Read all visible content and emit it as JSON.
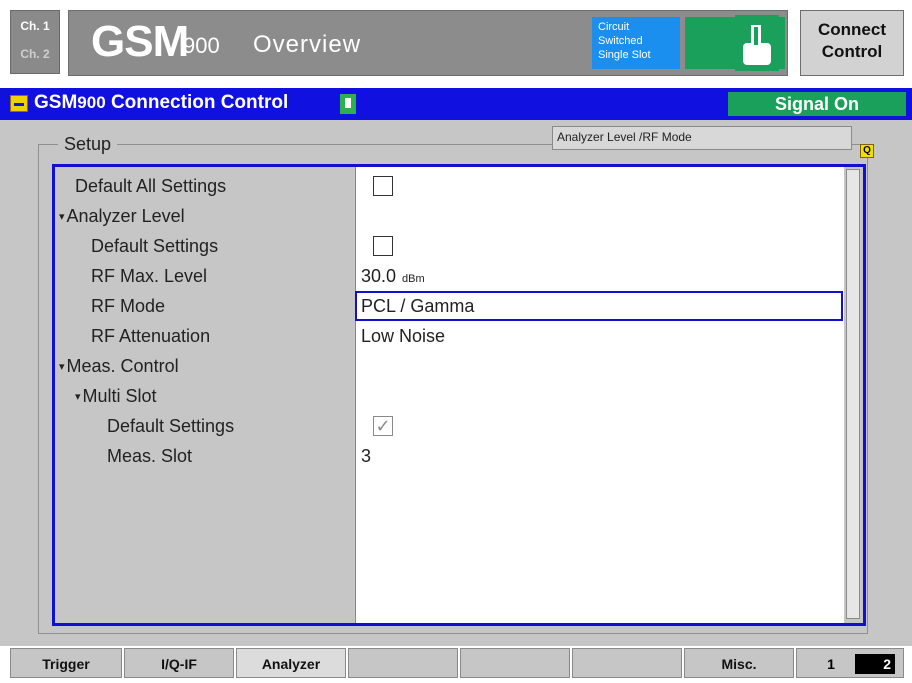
{
  "top": {
    "ch1": "Ch. 1",
    "ch2": "Ch. 2",
    "title_main": "GSM",
    "title_band": "900",
    "title_view": "Overview",
    "mode_lines": [
      "Circuit",
      "Switched",
      "Single Slot"
    ],
    "connect_lines": [
      "Connect",
      "Control"
    ]
  },
  "header": {
    "title_prefix": "GSM",
    "title_band": "900",
    "title": "Connection Control",
    "status": "Signal On",
    "status_color": "#1aa05a",
    "bar_color": "#1010e0"
  },
  "panel": {
    "setup_label": "Setup",
    "tab_indicator": "Analyzer Level /RF Mode",
    "q_icon": "Q"
  },
  "tree": {
    "default_all": "Default All Settings",
    "analyzer_level": "Analyzer Level",
    "default_settings": "Default Settings",
    "rf_max_level": "RF Max. Level",
    "rf_max_level_value": "30.0",
    "rf_max_level_unit": "dBm",
    "rf_mode": "RF Mode",
    "rf_mode_value": "PCL / Gamma",
    "rf_attenuation": "RF Attenuation",
    "rf_attenuation_value": "Low Noise",
    "meas_control": "Meas. Control",
    "multi_slot": "Multi Slot",
    "ms_default_settings": "Default Settings",
    "ms_default_check": "✓",
    "meas_slot": "Meas. Slot",
    "meas_slot_value": "3",
    "expand_glyph": "▾"
  },
  "softkeys": {
    "trigger": "Trigger",
    "iq_if": "I/Q-IF",
    "analyzer": "Analyzer",
    "misc": "Misc.",
    "page1": "1",
    "page2": "2"
  }
}
